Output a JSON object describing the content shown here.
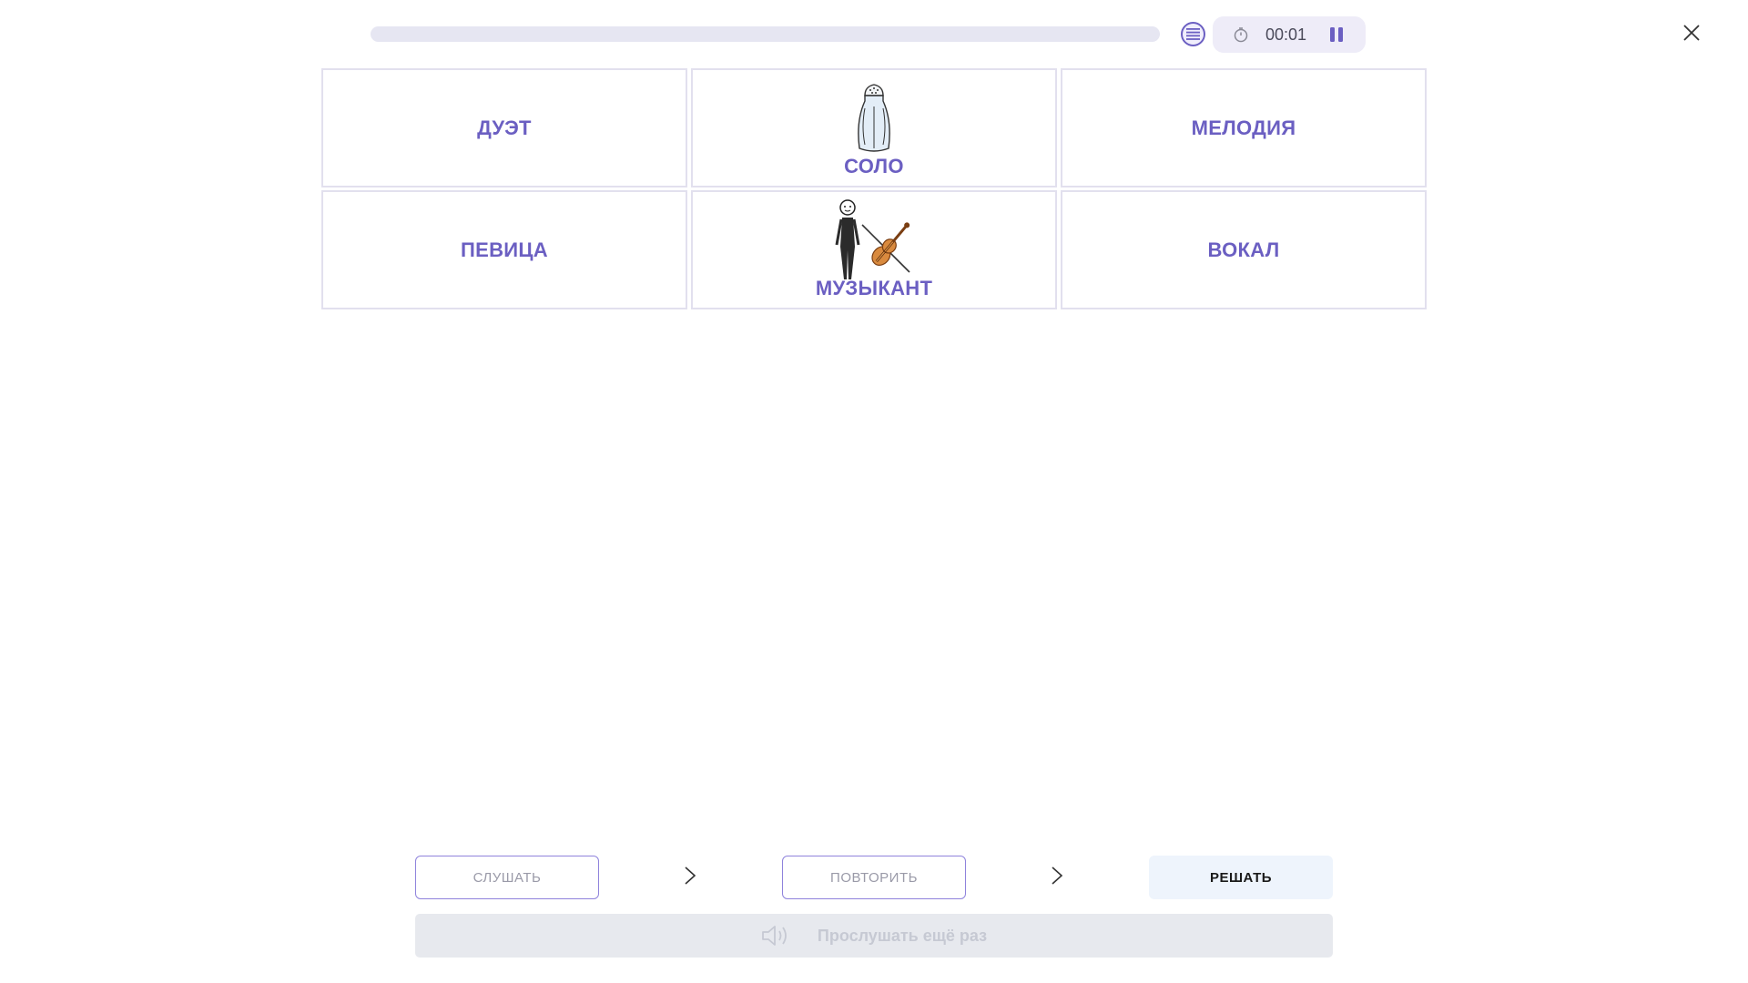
{
  "header": {
    "progress": 0,
    "timer": "00:01",
    "icons": {
      "list": "list-icon",
      "timer": "stopwatch-icon",
      "pause": "pause-icon",
      "close": "close-icon"
    }
  },
  "cards": [
    {
      "label": "ДУЭТ",
      "picture": null
    },
    {
      "label": "СОЛО",
      "picture": "salt-shaker"
    },
    {
      "label": "МЕЛОДИЯ",
      "picture": null
    },
    {
      "label": "ПЕВИЦА",
      "picture": null
    },
    {
      "label": "МУЗЫКАНТ",
      "picture": "person-with-violin"
    },
    {
      "label": "ВОКАЛ",
      "picture": null
    }
  ],
  "footer": {
    "listen_label": "СЛУШАТЬ",
    "repeat_label": "ПОВТОРИТЬ",
    "solve_label": "РЕШАТЬ",
    "replay_label": "Прослушать ещё раз"
  },
  "colors": {
    "accent": "#6b5fc2",
    "card_border": "#e2e0ee",
    "solve_bg": "#eef4fc",
    "replay_bg": "#e7e9ee"
  }
}
